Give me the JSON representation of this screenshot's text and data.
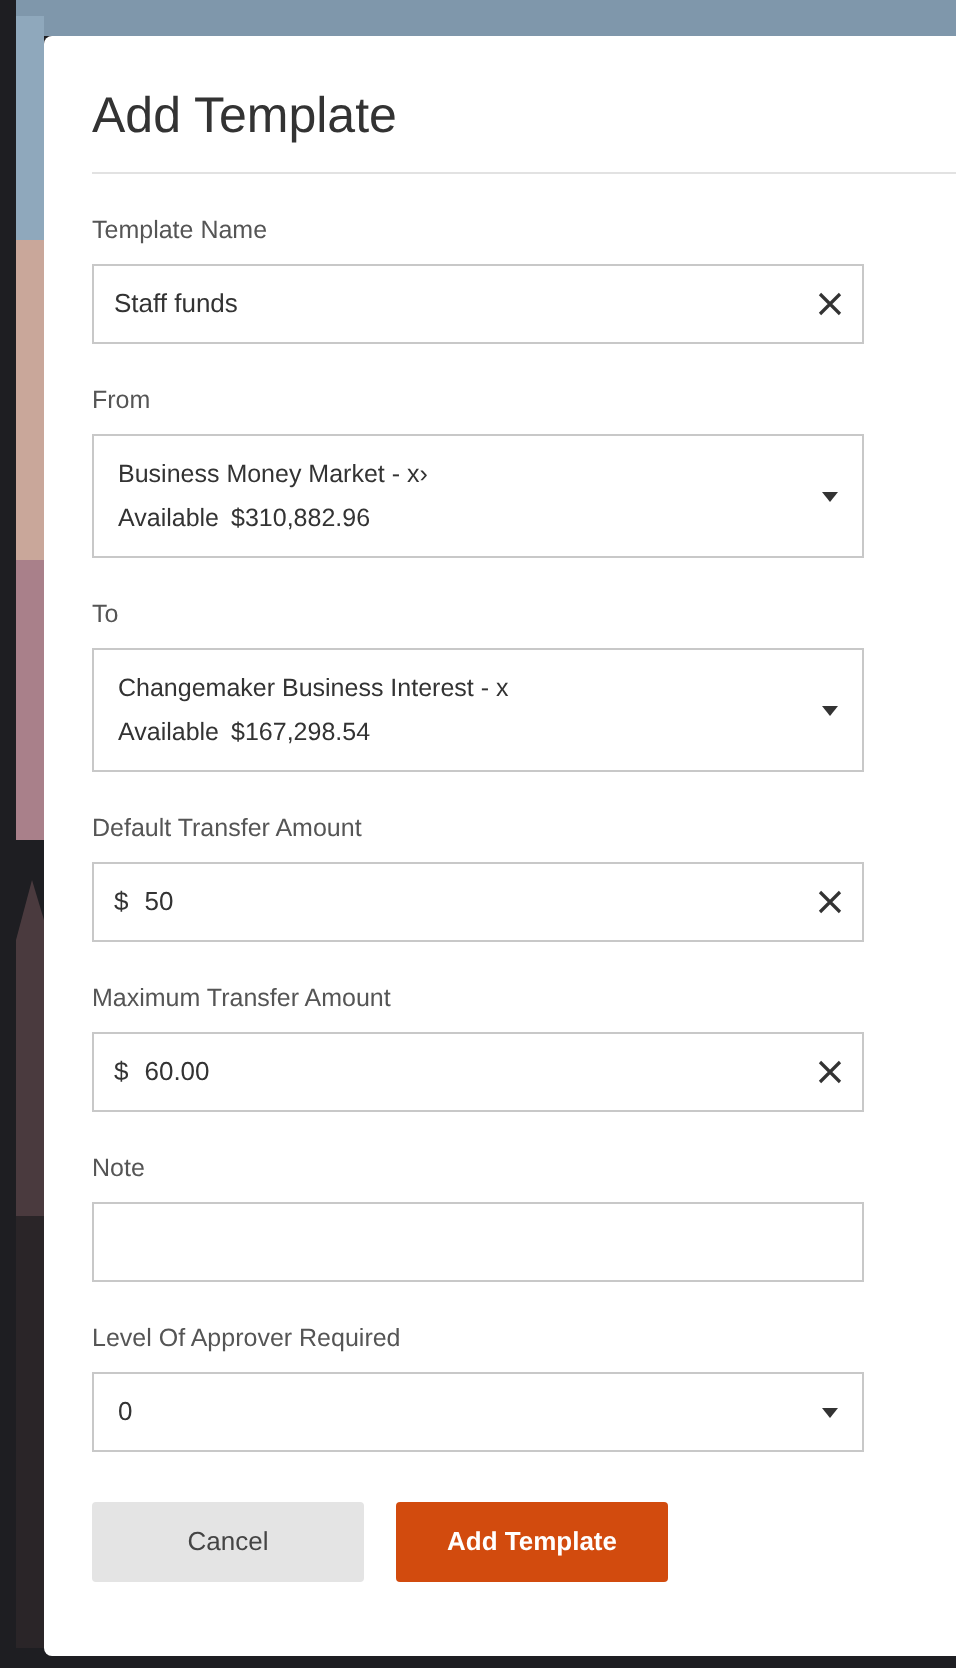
{
  "dialog": {
    "title": "Add Template"
  },
  "fields": [
    {
      "kind": "text",
      "label": "Template Name",
      "value": "Staff funds",
      "clearable": true
    },
    {
      "kind": "account",
      "label": "From",
      "value": "Business Money Market - x›",
      "balance_label": "Available",
      "balance": "$310,882.96"
    },
    {
      "kind": "account",
      "label": "To",
      "value": "Changemaker Business Interest - x",
      "balance_label": "Available",
      "balance": "$167,298.54"
    },
    {
      "kind": "text",
      "label": "Default Transfer Amount",
      "prefix": "$",
      "value": "50",
      "clearable": true
    },
    {
      "kind": "text",
      "label": "Maximum Transfer Amount",
      "prefix": "$",
      "value": "60.00",
      "clearable": true
    },
    {
      "kind": "text",
      "label": "Note",
      "clearable": false
    },
    {
      "kind": "select",
      "label": "Level Of Approver Required",
      "value": "0"
    }
  ],
  "buttons": [
    {
      "label": "Cancel",
      "kind": "secondary"
    },
    {
      "label": "Add Template",
      "kind": "primary"
    }
  ]
}
